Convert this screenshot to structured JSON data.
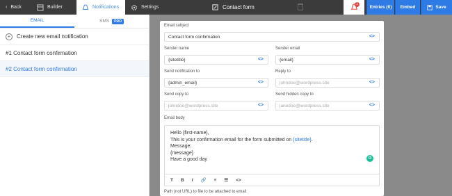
{
  "topbar": {
    "back_label": "Back",
    "builder_label": "Builder",
    "notifications_label": "Notifications",
    "settings_label": "Settings",
    "form_title": "Contact form",
    "alert_count": "1",
    "entries_label": "Entries (0)",
    "embed_label": "Embed",
    "save_label": "Save"
  },
  "sidebar": {
    "tabs": [
      {
        "label": "EMAIL"
      },
      {
        "label": "SMS",
        "badge": "PRO"
      }
    ],
    "create_label": "Create new email notification",
    "items": [
      {
        "label": "#1 Contact form confirmation"
      },
      {
        "label": "#2 Contact form confirmation"
      }
    ]
  },
  "form": {
    "email_subject": {
      "label": "Email subject",
      "value": "Contact form confirmation"
    },
    "sender_name": {
      "label": "Sender name",
      "value": "{sitetitle}"
    },
    "sender_email": {
      "label": "Sender email",
      "value": "{email}"
    },
    "send_to": {
      "label": "Send notification to",
      "value": "{admin_email}"
    },
    "reply_to": {
      "label": "Reply to",
      "placeholder": "johndoe@wordpress.site"
    },
    "send_copy": {
      "label": "Send copy to",
      "placeholder": "johndoe@wordpress.site"
    },
    "send_hidden": {
      "label": "Send hidden copy to",
      "placeholder": "janedoe@wordpress.site"
    },
    "body": {
      "label": "Email body",
      "line1": "Hello {first-name},",
      "line2_pre": "This is your confirmation email for the form submitted on ",
      "line2_link": "{sitetitle}",
      "line2_post": ".",
      "line3": "Message:",
      "line4": "{message}",
      "line5": "Have a good day"
    },
    "toolbar": [
      "T",
      "B",
      "I",
      "🔗",
      "≡",
      "☰",
      "<>"
    ],
    "attachment_label": "Path (not URL) to file to be attached to email"
  },
  "code_symbol": "<>"
}
